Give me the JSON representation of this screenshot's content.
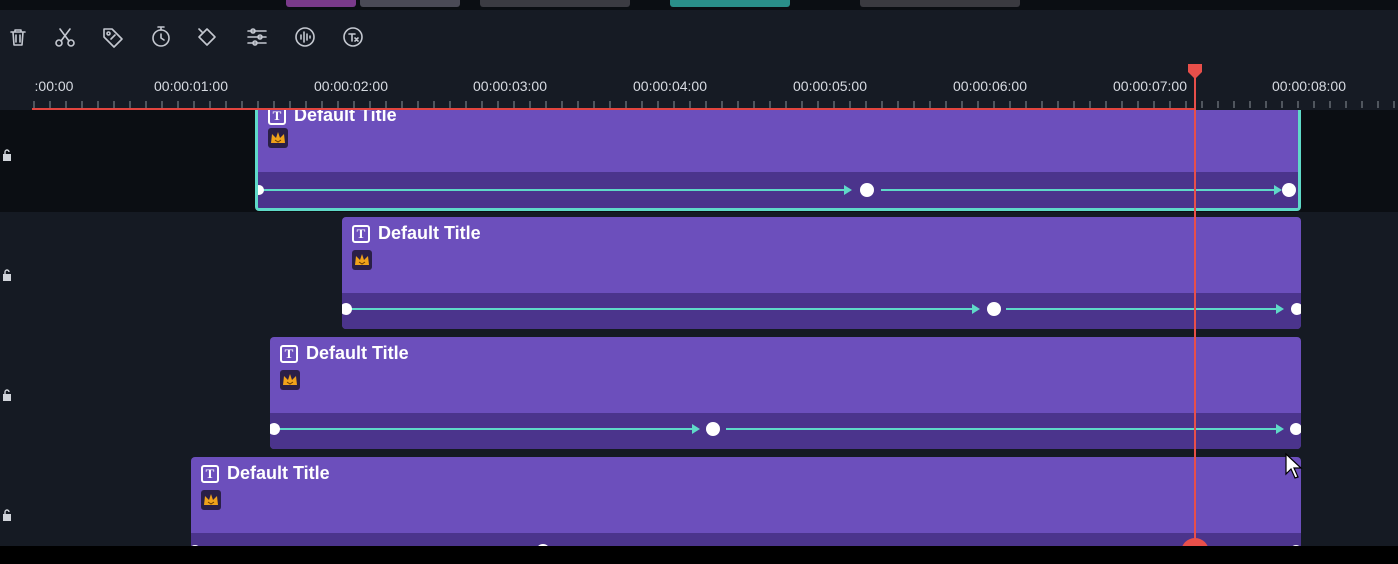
{
  "ruler": {
    "labels": [
      ":00:00",
      "00:00:01:00",
      "00:00:02:00",
      "00:00:03:00",
      "00:00:04:00",
      "00:00:05:00",
      "00:00:06:00",
      "00:00:07:00",
      "00:00:08:00"
    ]
  },
  "toolbar": {
    "tools": [
      "trash-icon",
      "scissors-icon",
      "tag-icon",
      "timer-icon",
      "keyframe-icon",
      "adjust-icon",
      "audio-icon",
      "speech-to-text-icon"
    ]
  },
  "tracks": [
    {
      "title": "Default Title",
      "selected": true
    },
    {
      "title": "Default Title",
      "selected": false
    },
    {
      "title": "Default Title",
      "selected": false
    },
    {
      "title": "Default Title",
      "selected": false
    }
  ],
  "playhead": {
    "time": "00:00:07:03"
  },
  "colors": {
    "clip": "#6c4fbc",
    "keyframe_band": "#4b348c",
    "keyframe_line": "#5fd9c8",
    "selection": "#5fd9c8",
    "playhead": "#e84f4a",
    "crown": "#f0a21a"
  }
}
